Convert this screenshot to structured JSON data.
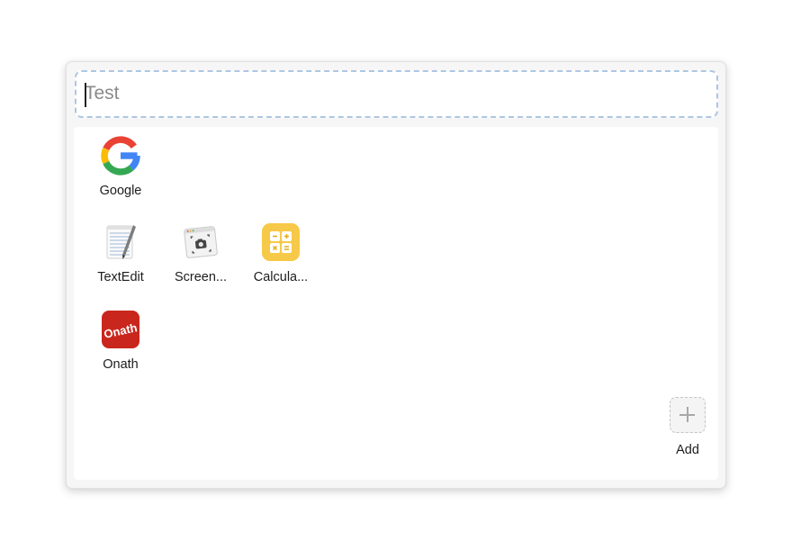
{
  "search": {
    "placeholder": "Test",
    "value": ""
  },
  "apps": [
    {
      "label": "Google",
      "icon": "google-icon"
    },
    {
      "label": "TextEdit",
      "icon": "textedit-icon"
    },
    {
      "label": "Screen...",
      "icon": "screenshot-icon"
    },
    {
      "label": "Calcula...",
      "icon": "calculator-icon"
    },
    {
      "label": "Onath",
      "icon": "onath-icon",
      "icon_text": "Onath"
    }
  ],
  "add": {
    "label": "Add",
    "icon": "plus-icon"
  },
  "colors": {
    "search_border": "#aec6e2",
    "calculator_bg": "#f7c948",
    "onath_bg": "#c9261d"
  }
}
